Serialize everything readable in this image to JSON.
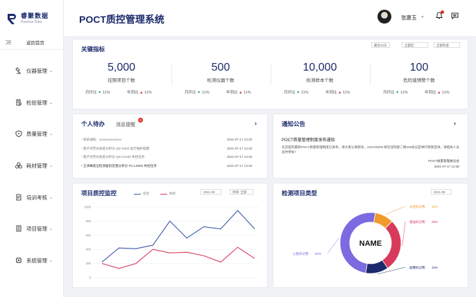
{
  "sidebar": {
    "logo_cn": "睿聚数据",
    "logo_en": "Ruishan Data",
    "back_label": "返回首页",
    "items": [
      {
        "label": "仪器管理",
        "icon": "microscope-icon"
      },
      {
        "label": "检验管理",
        "icon": "document-search-icon"
      },
      {
        "label": "质量管理",
        "icon": "shield-icon"
      },
      {
        "label": "耗材管理",
        "icon": "cluster-icon"
      },
      {
        "label": "培训考核",
        "icon": "edit-document-icon"
      },
      {
        "label": "项目管理",
        "icon": "list-document-icon"
      },
      {
        "label": "系统管理",
        "icon": "chip-icon"
      }
    ]
  },
  "header": {
    "title": "POCT质控管理系统",
    "username": "张惠玉",
    "notification_dot": true
  },
  "kpis": {
    "title": "关键指标",
    "filters": [
      "最近30天",
      "全部区",
      "全部科室"
    ],
    "items": [
      {
        "value": "5,000",
        "label": "控制项目个数",
        "mom": "月环比",
        "mom_val": "11%",
        "mom_dir": "down",
        "yoy": "年同比",
        "yoy_val": "11%",
        "yoy_dir": "up"
      },
      {
        "value": "500",
        "label": "检测仪器个数",
        "mom": "月环比",
        "mom_val": "11%",
        "mom_dir": "down",
        "yoy": "年同比",
        "yoy_val": "11%",
        "yoy_dir": "up"
      },
      {
        "value": "10,000",
        "label": "检测样本个数",
        "mom": "月环比",
        "mom_val": "11%",
        "mom_dir": "down",
        "yoy": "年同比",
        "yoy_val": "11%",
        "yoy_dir": "up"
      },
      {
        "value": "100",
        "label": "危险值预警个数",
        "mom": "月环比",
        "mom_val": "11%",
        "mom_dir": "down",
        "yoy": "年同比",
        "yoy_val": "11%",
        "yoy_dir": "up"
      }
    ]
  },
  "todo": {
    "title": "个人待办",
    "tab2": "消息提醒",
    "badge": "6",
    "rows": [
      {
        "text": "系统通知：xxxxxxxxxxxxxx",
        "date": "2021-07-17  12:30"
      },
      {
        "text": "量子点荧光免疫分析仪 QD-S600 运行维护提醒",
        "date": "2021-07-17  12:30"
      },
      {
        "text": "量子点荧光免疫分析仪 QD-S1200 失控任务",
        "date": "2021-07-17  12:30"
      },
      {
        "text": "王清峰提出检测差别定量分析仪 PC-L8000 失控任务",
        "date": "2021-07-17  12:30"
      }
    ]
  },
  "notice": {
    "title": "通知公告",
    "headline": "POCT质量管理制度发布通知",
    "body": "北京医院最新POCT质量管理制度已发布，请大家认真研读，2021/08/09 将在住院部二楼209会议室举行政策宣讲，请相关人员准时参加！",
    "signature": "POCT质量管理委员会",
    "date": "2021-07-17  12:30"
  },
  "qc": {
    "title": "项目质控监控",
    "filters": [
      "2021-08",
      "项目: 全部"
    ],
    "legend": [
      "在控",
      "失控"
    ]
  },
  "pie": {
    "title": "检测项目类型",
    "filter": "2021-08",
    "center": "NAME"
  },
  "chart_data": [
    {
      "type": "line",
      "title": "项目质控监控",
      "x": [
        1,
        2,
        3,
        4,
        5,
        6,
        7,
        8,
        9,
        10
      ],
      "ylim": [
        0,
        1000
      ],
      "yticks": [
        0,
        200,
        400,
        600,
        800,
        1000
      ],
      "series": [
        {
          "name": "在控",
          "values": [
            220,
            420,
            410,
            460,
            800,
            560,
            720,
            690,
            950,
            690
          ],
          "color": "#3b5aa6"
        },
        {
          "name": "失控",
          "values": [
            200,
            130,
            200,
            400,
            350,
            360,
            310,
            220,
            430,
            270
          ],
          "color": "#d83a5c"
        }
      ]
    },
    {
      "type": "pie",
      "title": "检测项目类型",
      "center_label": "NAME",
      "slices": [
        {
          "name": "心脏标记物",
          "value": 50,
          "color": "#7b6ae0"
        },
        {
          "name": "炎症标记物",
          "value": 10,
          "color": "#f2992b"
        },
        {
          "name": "凝血标记物",
          "value": 28,
          "color": "#d83a5c"
        },
        {
          "name": "血糖标记物",
          "value": 12,
          "color": "#1b2a6b"
        }
      ],
      "percent_labels": [
        "50%",
        "10%",
        "28%",
        "10%"
      ]
    }
  ]
}
